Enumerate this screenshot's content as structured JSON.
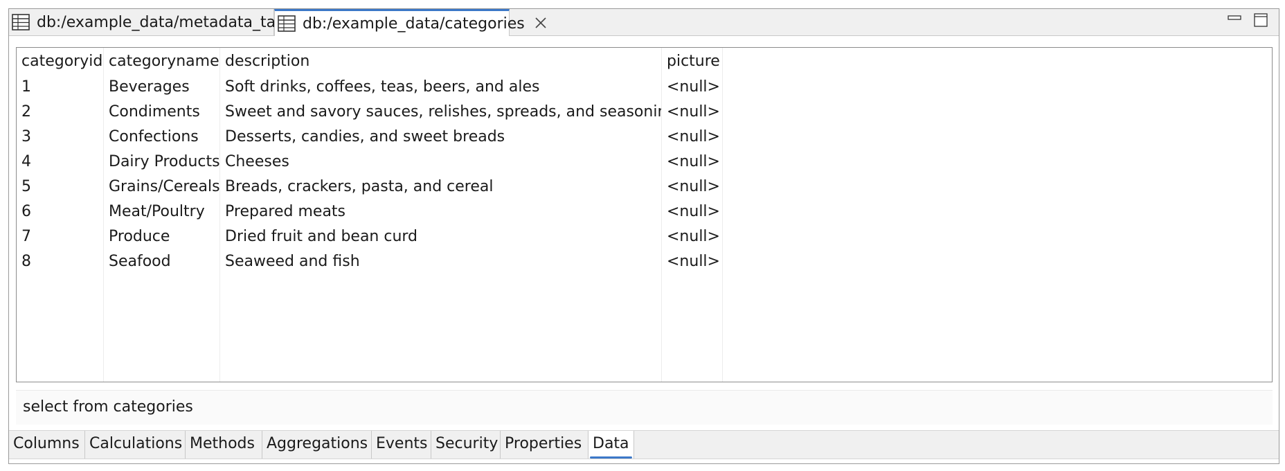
{
  "editor_tabs": [
    {
      "label": "db:/example_data/metadata_table",
      "icon": "table-icon",
      "active": false
    },
    {
      "label": "db:/example_data/categories",
      "icon": "table-icon",
      "active": true,
      "close_icon": "close-icon"
    }
  ],
  "window_controls": [
    "minimize-icon",
    "maximize-icon"
  ],
  "table": {
    "columns": [
      "categoryid",
      "categoryname",
      "description",
      "picture"
    ],
    "rows": [
      [
        "1",
        "Beverages",
        "Soft drinks, coffees, teas, beers, and ales",
        "<null>"
      ],
      [
        "2",
        "Condiments",
        "Sweet and savory sauces, relishes, spreads, and seasonings",
        "<null>"
      ],
      [
        "3",
        "Confections",
        "Desserts, candies, and sweet breads",
        "<null>"
      ],
      [
        "4",
        "Dairy Products",
        "Cheeses",
        "<null>"
      ],
      [
        "5",
        "Grains/Cereals",
        "Breads, crackers, pasta, and cereal",
        "<null>"
      ],
      [
        "6",
        "Meat/Poultry",
        "Prepared meats",
        "<null>"
      ],
      [
        "7",
        "Produce",
        "Dried fruit and bean curd",
        "<null>"
      ],
      [
        "8",
        "Seafood",
        "Seaweed and fish",
        "<null>"
      ]
    ]
  },
  "sql_query": "select from categories",
  "bottom_tabs": [
    {
      "label": "Columns",
      "active": false
    },
    {
      "label": "Calculations",
      "active": false
    },
    {
      "label": "Methods",
      "active": false
    },
    {
      "label": "Aggregations",
      "active": false
    },
    {
      "label": "Events",
      "active": false
    },
    {
      "label": "Security",
      "active": false
    },
    {
      "label": "Properties",
      "active": false
    },
    {
      "label": "Data",
      "active": true
    }
  ],
  "colors": {
    "accent": "#3c78c8",
    "border": "#8c8c8c",
    "background": "#f0f0f0"
  }
}
